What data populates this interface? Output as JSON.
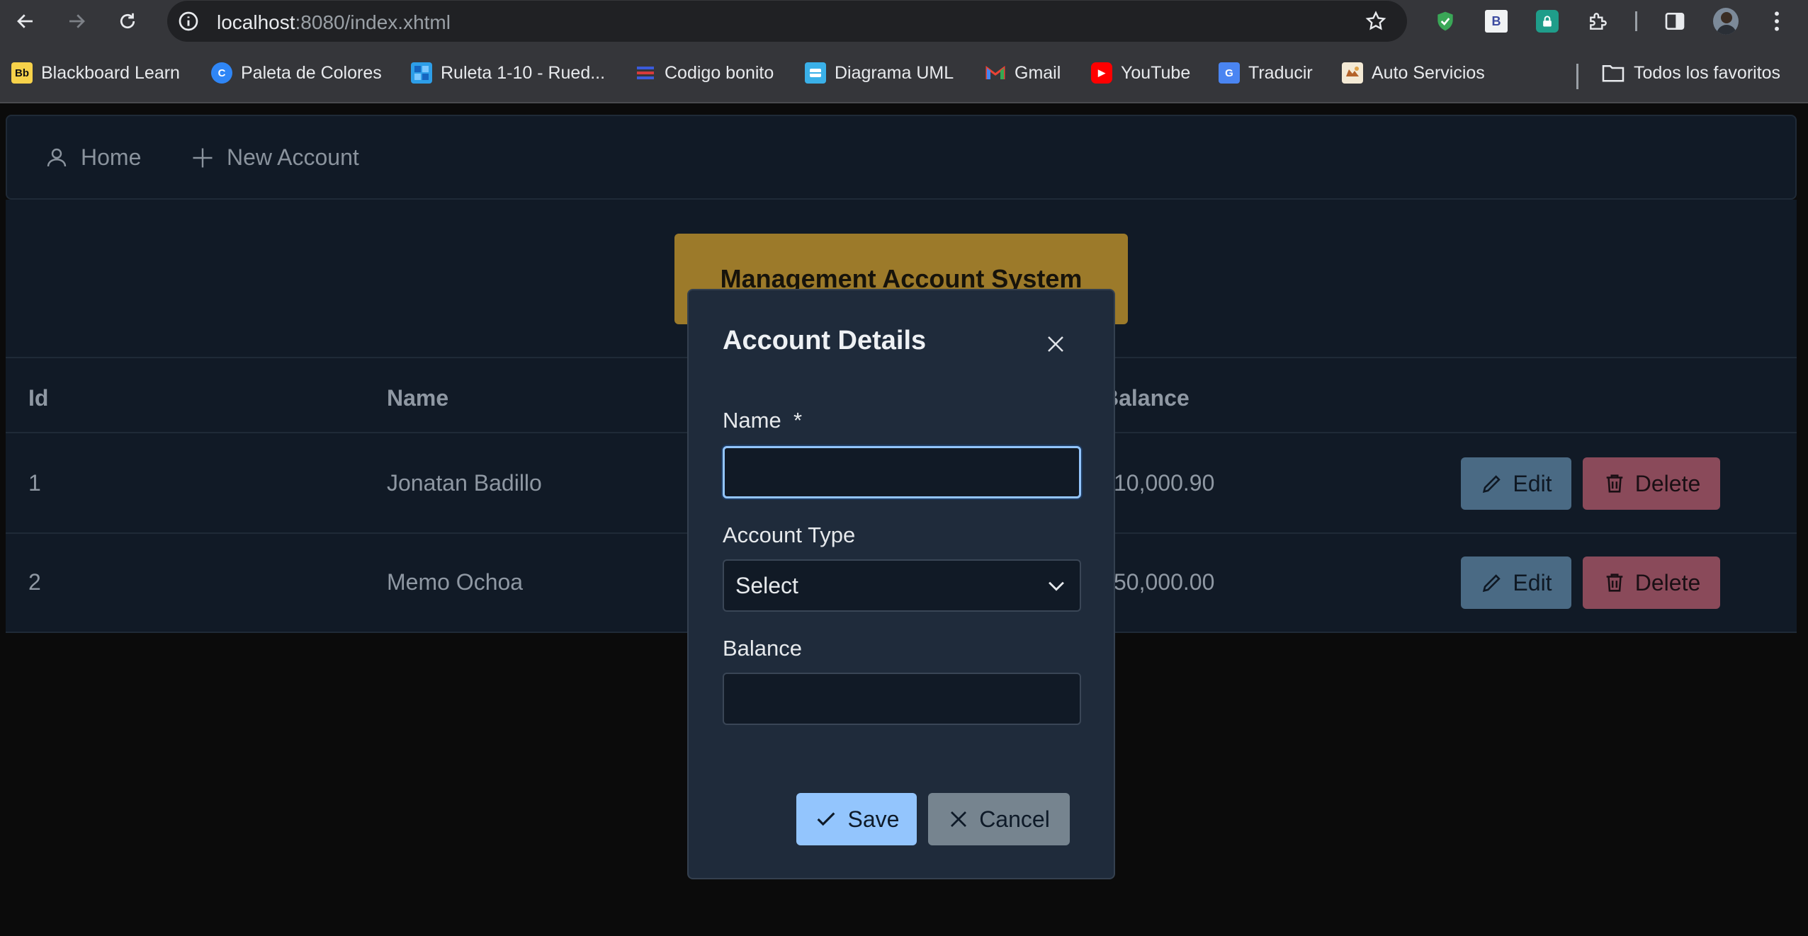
{
  "browser": {
    "url_host": "localhost",
    "url_rest": ":8080/index.xhtml",
    "bookmarks": [
      {
        "label": "Blackboard Learn",
        "icon": "blackboard-icon",
        "badge": "Bb"
      },
      {
        "label": "Paleta de Colores",
        "icon": "palette-icon",
        "badge": "C"
      },
      {
        "label": "Ruleta 1-10 - Rued...",
        "icon": "wheel-icon",
        "badge": ""
      },
      {
        "label": "Codigo bonito",
        "icon": "code-icon",
        "badge": ""
      },
      {
        "label": "Diagrama UML",
        "icon": "uml-icon",
        "badge": ""
      },
      {
        "label": "Gmail",
        "icon": "gmail-icon",
        "badge": "M"
      },
      {
        "label": "YouTube",
        "icon": "youtube-icon",
        "badge": "▶"
      },
      {
        "label": "Traducir",
        "icon": "translate-icon",
        "badge": "G"
      },
      {
        "label": "Auto Servicios",
        "icon": "auto-icon",
        "badge": ""
      }
    ],
    "all_bookmarks_label": "Todos los favoritos"
  },
  "menu": {
    "home_label": "Home",
    "new_account_label": "New Account"
  },
  "header": {
    "title": "Management Account System"
  },
  "table": {
    "columns": [
      "Id",
      "Name",
      "",
      "Balance"
    ],
    "rows": [
      {
        "id": "1",
        "name": "Jonatan Badillo",
        "balance": "10,000.90"
      },
      {
        "id": "2",
        "name": "Memo Ochoa",
        "balance": "50,000.00"
      }
    ],
    "edit_label": "Edit",
    "delete_label": "Delete"
  },
  "dialog": {
    "title": "Account Details",
    "name_label": "Name",
    "required_mark": "*",
    "name_value": "",
    "account_type_label": "Account Type",
    "account_type_value": "Select",
    "balance_label": "Balance",
    "balance_value": "",
    "save_label": "Save",
    "cancel_label": "Cancel"
  },
  "colors": {
    "accent": "#93c5fd",
    "title_button": "#9c7a2a",
    "edit_button": "#4a6a84",
    "delete_button": "#8a4a5a",
    "surface": "#111a26",
    "dialog_surface": "#1f2b3b"
  }
}
